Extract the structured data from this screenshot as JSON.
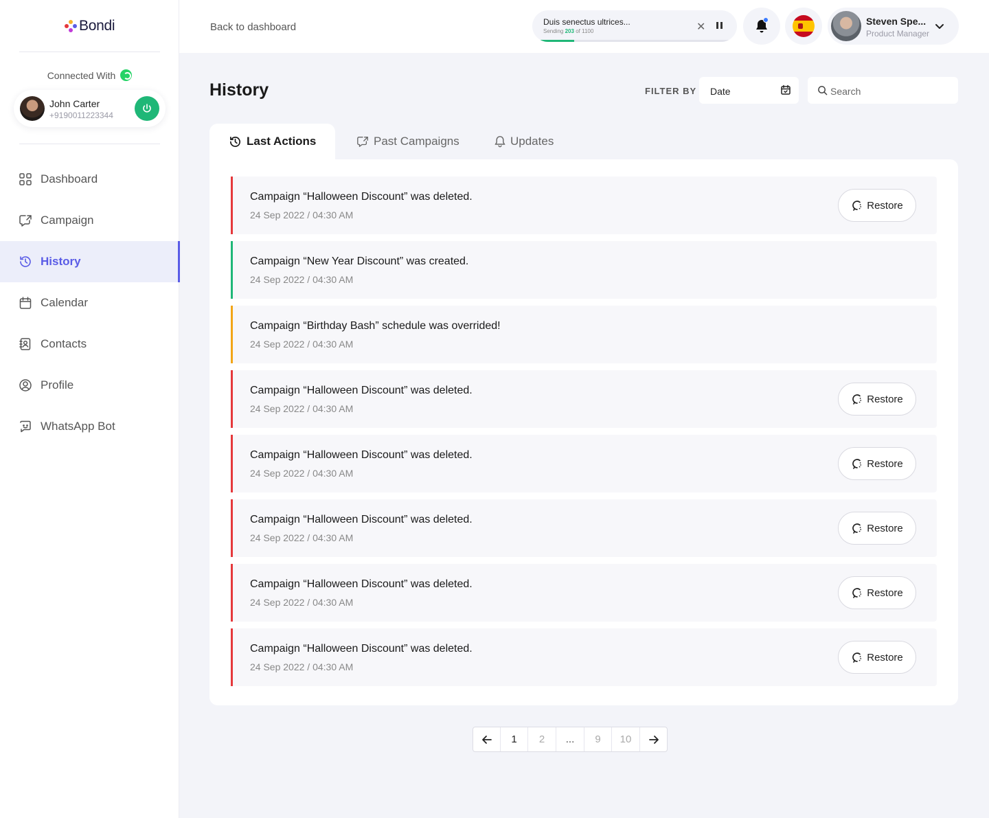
{
  "brand": {
    "name": "Bondi"
  },
  "sidebar": {
    "connected_label": "Connected With",
    "account": {
      "name": "John Carter",
      "phone": "+9190011223344"
    },
    "items": [
      {
        "label": "Dashboard",
        "icon": "grid-icon"
      },
      {
        "label": "Campaign",
        "icon": "campaign-icon"
      },
      {
        "label": "History",
        "icon": "history-icon",
        "active": true
      },
      {
        "label": "Calendar",
        "icon": "calendar-icon"
      },
      {
        "label": "Contacts",
        "icon": "contacts-icon"
      },
      {
        "label": "Profile",
        "icon": "profile-icon"
      },
      {
        "label": "WhatsApp Bot",
        "icon": "chat-bot-icon"
      }
    ]
  },
  "topbar": {
    "back_label": "Back to dashboard",
    "sending": {
      "title": "Duis senectus ultrices...",
      "prefix": "Sending",
      "sent": "203",
      "middle": "of",
      "total": "1100",
      "progress": 0.185
    },
    "user": {
      "name": "Steven Spe...",
      "role": "Product Manager"
    }
  },
  "main": {
    "title": "History",
    "filter_label": "FILTER BY",
    "date_value": "Date",
    "search_placeholder": "Search",
    "tabs": [
      {
        "label": "Last Actions",
        "active": true
      },
      {
        "label": "Past Campaigns"
      },
      {
        "label": "Updates"
      }
    ],
    "restore_label": "Restore",
    "rows": [
      {
        "message": "Campaign “Halloween Discount” was deleted.",
        "time": "24 Sep 2022 / 04:30 AM",
        "status_color": "#e5383b",
        "restorable": true
      },
      {
        "message": "Campaign “New Year Discount” was created.",
        "time": "24 Sep 2022 / 04:30 AM",
        "status_color": "#1fb777",
        "restorable": false
      },
      {
        "message": "Campaign “Birthday Bash” schedule was overrided!",
        "time": "24 Sep 2022 / 04:30 AM",
        "status_color": "#f2a516",
        "restorable": false
      },
      {
        "message": "Campaign “Halloween Discount” was deleted.",
        "time": "24 Sep 2022 / 04:30 AM",
        "status_color": "#e5383b",
        "restorable": true
      },
      {
        "message": "Campaign “Halloween Discount” was deleted.",
        "time": "24 Sep 2022 / 04:30 AM",
        "status_color": "#e5383b",
        "restorable": true
      },
      {
        "message": "Campaign “Halloween Discount” was deleted.",
        "time": "24 Sep 2022 / 04:30 AM",
        "status_color": "#e5383b",
        "restorable": true
      },
      {
        "message": "Campaign “Halloween Discount” was deleted.",
        "time": "24 Sep 2022 / 04:30 AM",
        "status_color": "#e5383b",
        "restorable": true
      },
      {
        "message": "Campaign “Halloween Discount” was deleted.",
        "time": "24 Sep 2022 / 04:30 AM",
        "status_color": "#e5383b",
        "restorable": true
      }
    ]
  },
  "pagination": {
    "pages": [
      "1",
      "2",
      "...",
      "9",
      "10"
    ],
    "current": "1"
  },
  "colors": {
    "accent": "#5a5ce6",
    "success": "#1fb777",
    "danger": "#e5383b",
    "warning": "#f2a516"
  }
}
